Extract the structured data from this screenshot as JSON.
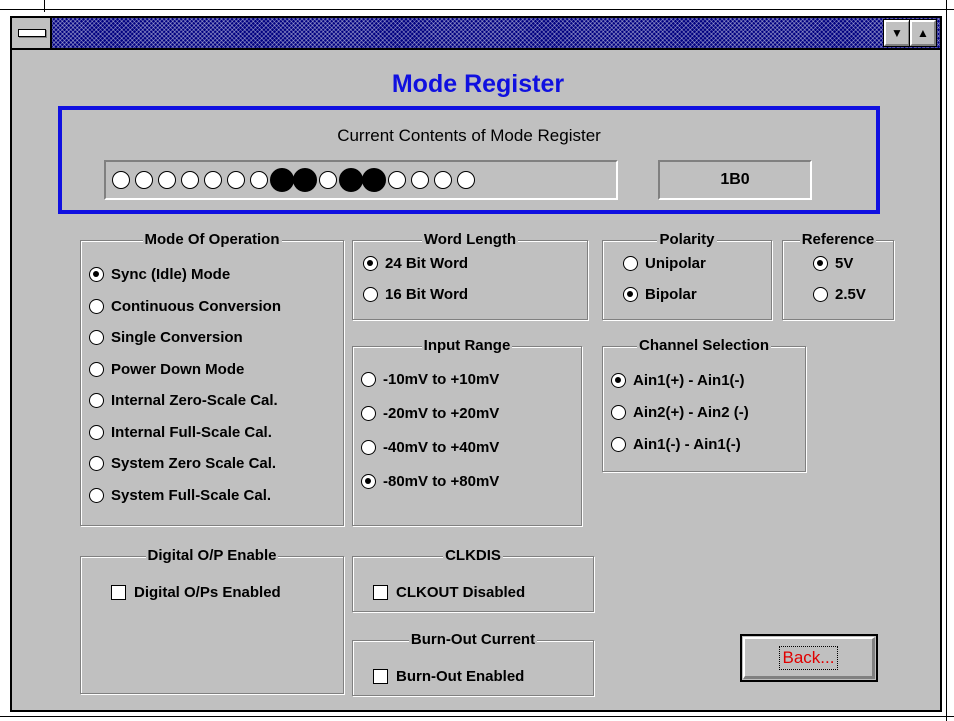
{
  "window": {
    "title": "Mode Register",
    "minimize_glyph": "▼",
    "maximize_glyph": "▲"
  },
  "register": {
    "caption": "Current Contents of Mode Register",
    "bits": [
      0,
      0,
      0,
      0,
      0,
      0,
      0,
      1,
      1,
      0,
      1,
      1,
      0,
      0,
      0,
      0
    ],
    "hex_value": "1B0"
  },
  "mode_of_operation": {
    "label": "Mode Of Operation",
    "options": [
      "Sync (Idle) Mode",
      "Continuous Conversion",
      "Single Conversion",
      "Power Down Mode",
      "Internal Zero-Scale Cal.",
      "Internal Full-Scale Cal.",
      "System Zero Scale Cal.",
      "System Full-Scale Cal."
    ],
    "selected": 0
  },
  "word_length": {
    "label": "Word Length",
    "options": [
      "24 Bit Word",
      "16 Bit Word"
    ],
    "selected": 0
  },
  "polarity": {
    "label": "Polarity",
    "options": [
      "Unipolar",
      "Bipolar"
    ],
    "selected": 1
  },
  "reference": {
    "label": "Reference",
    "options": [
      "5V",
      "2.5V"
    ],
    "selected": 0
  },
  "input_range": {
    "label": "Input Range",
    "options": [
      "-10mV to +10mV",
      "-20mV to +20mV",
      "-40mV to +40mV",
      "-80mV to +80mV"
    ],
    "selected": 3
  },
  "channel_selection": {
    "label": "Channel Selection",
    "options": [
      "Ain1(+) - Ain1(-)",
      "Ain2(+) - Ain2 (-)",
      "Ain1(-) - Ain1(-)"
    ],
    "selected": 0
  },
  "digital_op": {
    "label": "Digital O/P Enable",
    "checkbox": "Digital O/Ps Enabled",
    "checked": false
  },
  "clkdis": {
    "label": "CLKDIS",
    "checkbox": "CLKOUT Disabled",
    "checked": false
  },
  "burnout": {
    "label": "Burn-Out Current",
    "checkbox": "Burn-Out Enabled",
    "checked": false
  },
  "back_button": {
    "label": "Back..."
  }
}
